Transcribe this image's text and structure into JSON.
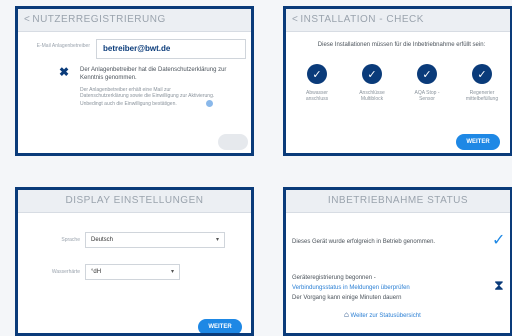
{
  "panel1": {
    "header": "NUTZERREGISTRIERUNG",
    "email_label": "E-Mail Anlagenbetreiber",
    "email_value": "betreiber@bwt.de",
    "consent_text": "Der Anlagenbetreiber hat die Datenschutzerklärung zur Kenntnis genommen.",
    "note_line1": "Der Anlagenbetreiber erhält eine Mail zur",
    "note_line2": "Datenschutzerklärung sowie die Einwilligung zur Aktivierung.",
    "note_line3": "Unbedingt auch die Einwilligung bestätigen.",
    "button": ""
  },
  "panel2": {
    "header": "INSTALLATION - CHECK",
    "intro": "Diese Installationen müssen für die Inbetriebnahme erfüllt sein:",
    "items": [
      {
        "label": "Abwasser anschluss"
      },
      {
        "label": "Anschlüsse Multiblock"
      },
      {
        "label": "AQA Stop - Sensor"
      },
      {
        "label": "Regenerier mittelbefüllung"
      }
    ],
    "button": "WEITER"
  },
  "panel3": {
    "header": "DISPLAY EINSTELLUNGEN",
    "language_label": "Sprache",
    "language_value": "Deutsch",
    "unit_label": "Wasserhärte",
    "unit_value": "°dH",
    "button": "WEITER"
  },
  "panel4": {
    "header": "INBETRIEBNAHME STATUS",
    "success_text": "Dieses Gerät wurde erfolgreich in Betrieb genommen.",
    "reg_started": "Geräteregistrierung begonnen -",
    "reg_link": "Verbindungsstatus in Meldungen überprüfen",
    "wait_text": "Der Vorgang kann einige Minuten dauern",
    "home_link": "Weiter zur Statusübersicht"
  },
  "colors": {
    "border": "#0a3b7a",
    "accent": "#1e88e5",
    "icon": "#0a3b7a"
  }
}
